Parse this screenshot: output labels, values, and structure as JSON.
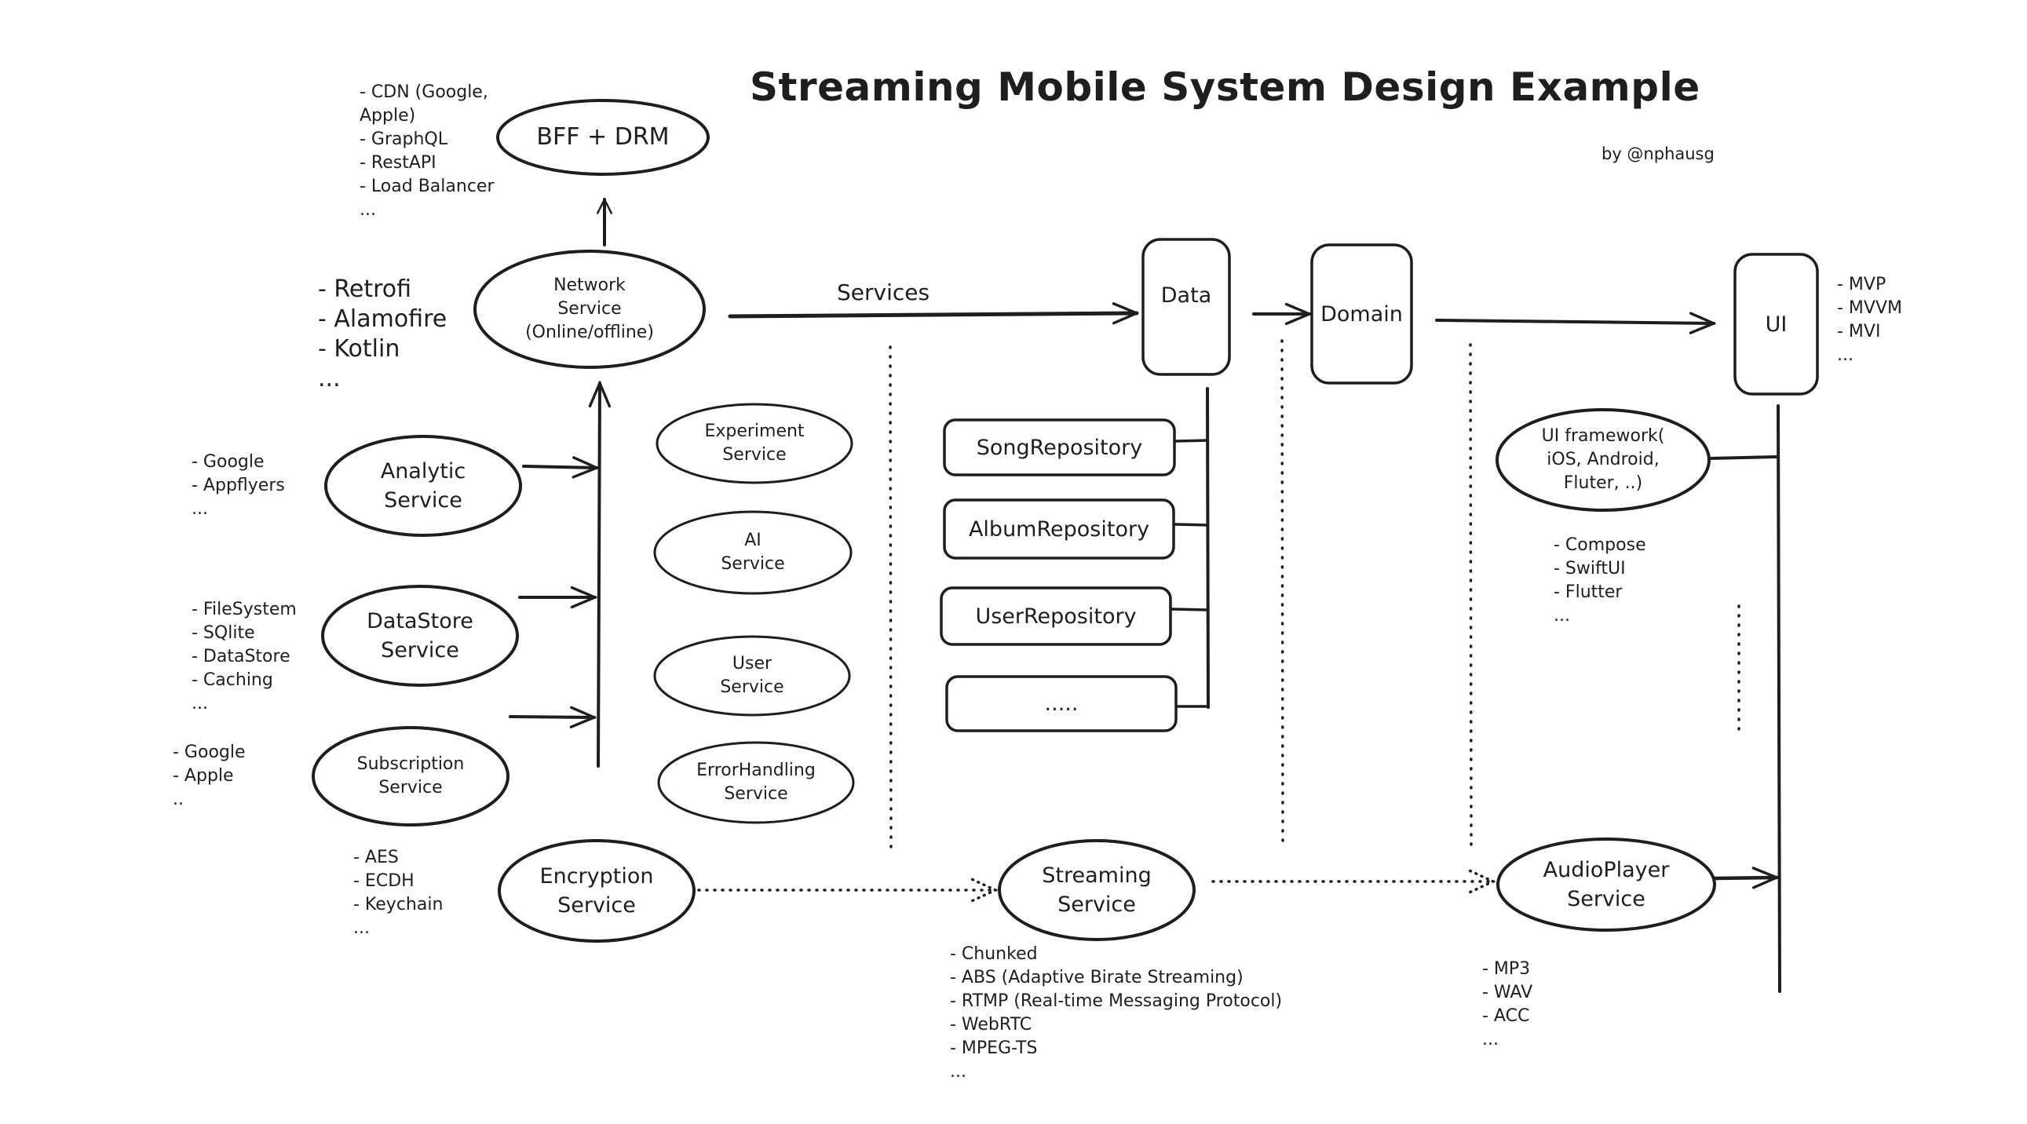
{
  "title": "Streaming Mobile System Design Example",
  "byline": "by @nphausg",
  "edge_labels": {
    "services": "Services"
  },
  "nodes": {
    "bff": "BFF + DRM",
    "network": "Network\nService\n(Online/offline)",
    "analytic": "Analytic\nService",
    "datastore": "DataStore\nService",
    "subscription": "Subscription\nService",
    "encryption": "Encryption\nService",
    "experiment": "Experiment\nService",
    "ai": "AI\nService",
    "user": "User\nService",
    "errorhandling": "ErrorHandling\nService",
    "data": "Data",
    "domain": "Domain",
    "ui": "UI",
    "ui_framework": "UI framework(\niOS, Android,\nFluter, ..)",
    "streaming": "Streaming\nService",
    "audioplayer": "AudioPlayer\nService"
  },
  "repositories": [
    "SongRepository",
    "AlbumRepository",
    "UserRepository",
    "....."
  ],
  "notes": {
    "bff": [
      "- CDN (Google,",
      "Apple)",
      "- GraphQL",
      "- RestAPI",
      "- Load Balancer",
      "..."
    ],
    "network": [
      "- Retrofi",
      "- Alamofire",
      "- Kotlin",
      "..."
    ],
    "analytic": [
      "- Google",
      "- Appflyers",
      "..."
    ],
    "datastore": [
      "- FileSystem",
      "- SQlite",
      "- DataStore",
      "- Caching",
      "..."
    ],
    "subscription": [
      "- Google",
      "- Apple",
      ".."
    ],
    "encryption": [
      "- AES",
      "- ECDH",
      "- Keychain",
      "..."
    ],
    "streaming": [
      "- Chunked",
      "- ABS (Adaptive Birate Streaming)",
      "- RTMP (Real-time Messaging Protocol)",
      "- WebRTC",
      "- MPEG-TS",
      "..."
    ],
    "audioplayer": [
      "- MP3",
      "- WAV",
      "- ACC",
      "..."
    ],
    "ui": [
      "- MVP",
      "- MVVM",
      "- MVI",
      "..."
    ],
    "ui_framework": [
      "- Compose",
      "- SwiftUI",
      "- Flutter",
      "..."
    ]
  },
  "colors": {
    "stroke": "#1e1e1e",
    "background": "#ffffff"
  }
}
